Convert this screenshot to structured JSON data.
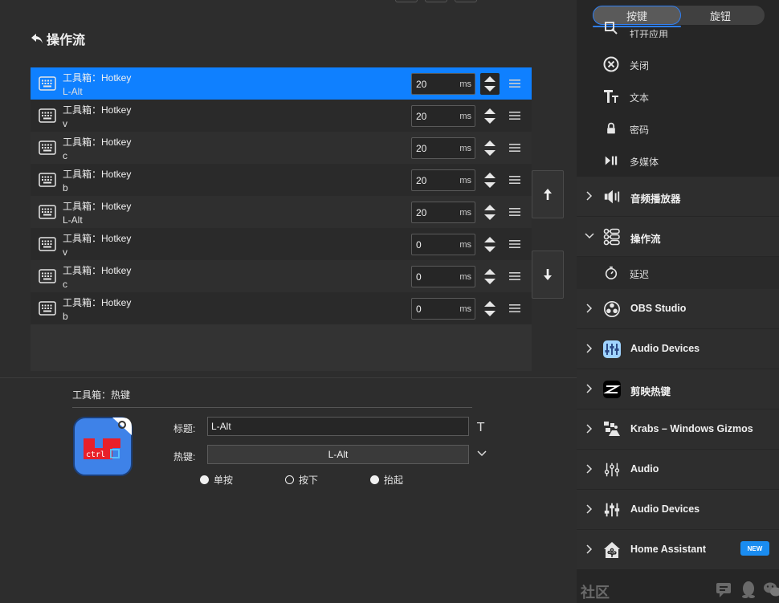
{
  "header": {
    "title": "操作流"
  },
  "actions": [
    {
      "title": "工具箱：Hotkey",
      "key": "L-Alt",
      "delay": "20",
      "unit": "ms"
    },
    {
      "title": "工具箱：Hotkey",
      "key": "v",
      "delay": "20",
      "unit": "ms"
    },
    {
      "title": "工具箱：Hotkey",
      "key": "c",
      "delay": "20",
      "unit": "ms"
    },
    {
      "title": "工具箱：Hotkey",
      "key": "b",
      "delay": "20",
      "unit": "ms"
    },
    {
      "title": "工具箱：Hotkey",
      "key": "L-Alt",
      "delay": "20",
      "unit": "ms"
    },
    {
      "title": "工具箱：Hotkey",
      "key": "v",
      "delay": "0",
      "unit": "ms"
    },
    {
      "title": "工具箱：Hotkey",
      "key": "c",
      "delay": "0",
      "unit": "ms"
    },
    {
      "title": "工具箱：Hotkey",
      "key": "b",
      "delay": "0",
      "unit": "ms"
    }
  ],
  "selected_action_index": 0,
  "detail": {
    "heading": "工具箱：热键",
    "icon_text": "ctrl",
    "title_label": "标题:",
    "title_value": "L-Alt",
    "hotkey_label": "热键:",
    "hotkey_value": "L-Alt",
    "modes": [
      "单按",
      "按下",
      "抬起"
    ]
  },
  "sidebar": {
    "tabs": [
      "按键",
      "旋钮"
    ],
    "active_tab": "按键",
    "partial_item": "打开应用",
    "toolbox_items": [
      {
        "label": "关闭",
        "icon": "close-circle-icon"
      },
      {
        "label": "文本",
        "icon": "text-icon"
      },
      {
        "label": "密码",
        "icon": "lock-icon"
      },
      {
        "label": "多媒体",
        "icon": "media-play-pause-icon"
      }
    ],
    "categories": [
      {
        "label": "音频播放器",
        "icon": "speaker-icon",
        "expanded": false
      },
      {
        "label": "操作流",
        "icon": "flow-icon",
        "expanded": true
      },
      {
        "label": "OBS Studio",
        "icon": "obs-icon",
        "expanded": false
      },
      {
        "label": "Audio Devices",
        "icon": "mixer-app-icon",
        "expanded": false
      },
      {
        "label": "剪映热键",
        "icon": "capcut-icon",
        "expanded": false
      },
      {
        "label": "Krabs – Windows Gizmos",
        "icon": "gizmos-icon",
        "expanded": false
      },
      {
        "label": "Audio",
        "icon": "sliders-icon",
        "expanded": false
      },
      {
        "label": "Audio Devices",
        "icon": "faders-icon",
        "expanded": false
      },
      {
        "label": "Home Assistant",
        "icon": "home-icon",
        "expanded": false,
        "badge": "NEW"
      }
    ],
    "flow_sub_items": [
      {
        "label": "延迟",
        "icon": "timer-icon"
      }
    ],
    "footer": {
      "label": "社区"
    }
  },
  "colors": {
    "selected": "#0f80ff",
    "accent": "#2f7ff3",
    "badge": "#1a8cf0"
  }
}
